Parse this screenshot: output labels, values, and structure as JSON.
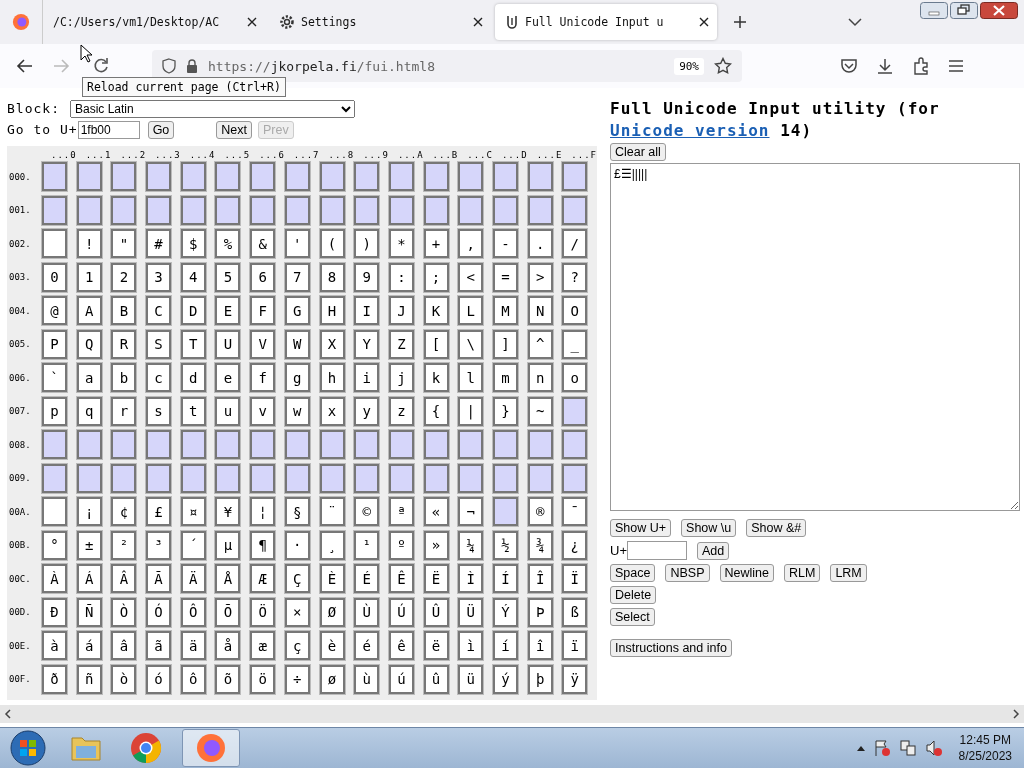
{
  "browser": {
    "tabs": [
      {
        "kind": "file",
        "title": "/C:/Users/vm1/Desktop/AC",
        "selected": false
      },
      {
        "kind": "settings",
        "title": "Settings",
        "selected": false
      },
      {
        "kind": "page",
        "title": "Full Unicode Input u",
        "selected": true
      }
    ],
    "url_scheme": "https://",
    "url_host": "jkorpela.fi",
    "url_path": "/fui.html8",
    "zoom": "90%",
    "tooltip": "Reload current page (Ctrl+R)"
  },
  "block": {
    "label": "Block:",
    "value": "Basic Latin"
  },
  "goto": {
    "label": "Go to U+",
    "value": "1fb00",
    "go": "Go",
    "next": "Next",
    "prev": "Prev",
    "prev_disabled": true
  },
  "grid": {
    "columns": [
      "...0",
      "...1",
      "...2",
      "...3",
      "...4",
      "...5",
      "...6",
      "...7",
      "...8",
      "...9",
      "...A",
      "...B",
      "...C",
      "...D",
      "...E",
      "...F"
    ],
    "rows": [
      {
        "label": "000.",
        "cells": [
          {
            "kind": "unassigned"
          },
          {
            "kind": "unassigned"
          },
          {
            "kind": "unassigned"
          },
          {
            "kind": "unassigned"
          },
          {
            "kind": "unassigned"
          },
          {
            "kind": "unassigned"
          },
          {
            "kind": "unassigned"
          },
          {
            "kind": "unassigned"
          },
          {
            "kind": "unassigned"
          },
          {
            "kind": "unassigned"
          },
          {
            "kind": "unassigned"
          },
          {
            "kind": "unassigned"
          },
          {
            "kind": "unassigned"
          },
          {
            "kind": "unassigned"
          },
          {
            "kind": "unassigned"
          },
          {
            "kind": "unassigned"
          }
        ]
      },
      {
        "label": "001.",
        "cells": [
          {
            "kind": "unassigned"
          },
          {
            "kind": "unassigned"
          },
          {
            "kind": "unassigned"
          },
          {
            "kind": "unassigned"
          },
          {
            "kind": "unassigned"
          },
          {
            "kind": "unassigned"
          },
          {
            "kind": "unassigned"
          },
          {
            "kind": "unassigned"
          },
          {
            "kind": "unassigned"
          },
          {
            "kind": "unassigned"
          },
          {
            "kind": "unassigned"
          },
          {
            "kind": "unassigned"
          },
          {
            "kind": "unassigned"
          },
          {
            "kind": "unassigned"
          },
          {
            "kind": "unassigned"
          },
          {
            "kind": "unassigned"
          }
        ]
      },
      {
        "label": "002.",
        "cells": [
          {
            "kind": "blank"
          },
          {
            "kind": "glyph",
            "char": "!"
          },
          {
            "kind": "glyph",
            "char": "\""
          },
          {
            "kind": "glyph",
            "char": "#"
          },
          {
            "kind": "glyph",
            "char": "$"
          },
          {
            "kind": "glyph",
            "char": "%"
          },
          {
            "kind": "glyph",
            "char": "&"
          },
          {
            "kind": "glyph",
            "char": "'"
          },
          {
            "kind": "glyph",
            "char": "("
          },
          {
            "kind": "glyph",
            "char": ")"
          },
          {
            "kind": "glyph",
            "char": "*"
          },
          {
            "kind": "glyph",
            "char": "+"
          },
          {
            "kind": "glyph",
            "char": ","
          },
          {
            "kind": "glyph",
            "char": "-"
          },
          {
            "kind": "glyph",
            "char": "."
          },
          {
            "kind": "glyph",
            "char": "/"
          }
        ]
      },
      {
        "label": "003.",
        "cells": [
          {
            "kind": "glyph",
            "char": "0"
          },
          {
            "kind": "glyph",
            "char": "1"
          },
          {
            "kind": "glyph",
            "char": "2"
          },
          {
            "kind": "glyph",
            "char": "3"
          },
          {
            "kind": "glyph",
            "char": "4"
          },
          {
            "kind": "glyph",
            "char": "5"
          },
          {
            "kind": "glyph",
            "char": "6"
          },
          {
            "kind": "glyph",
            "char": "7"
          },
          {
            "kind": "glyph",
            "char": "8"
          },
          {
            "kind": "glyph",
            "char": "9"
          },
          {
            "kind": "glyph",
            "char": ":"
          },
          {
            "kind": "glyph",
            "char": ";"
          },
          {
            "kind": "glyph",
            "char": "<"
          },
          {
            "kind": "glyph",
            "char": "="
          },
          {
            "kind": "glyph",
            "char": ">"
          },
          {
            "kind": "glyph",
            "char": "?"
          }
        ]
      },
      {
        "label": "004.",
        "cells": [
          {
            "kind": "glyph",
            "char": "@"
          },
          {
            "kind": "glyph",
            "char": "A"
          },
          {
            "kind": "glyph",
            "char": "B"
          },
          {
            "kind": "glyph",
            "char": "C"
          },
          {
            "kind": "glyph",
            "char": "D"
          },
          {
            "kind": "glyph",
            "char": "E"
          },
          {
            "kind": "glyph",
            "char": "F"
          },
          {
            "kind": "glyph",
            "char": "G"
          },
          {
            "kind": "glyph",
            "char": "H"
          },
          {
            "kind": "glyph",
            "char": "I"
          },
          {
            "kind": "glyph",
            "char": "J"
          },
          {
            "kind": "glyph",
            "char": "K"
          },
          {
            "kind": "glyph",
            "char": "L"
          },
          {
            "kind": "glyph",
            "char": "M"
          },
          {
            "kind": "glyph",
            "char": "N"
          },
          {
            "kind": "glyph",
            "char": "O"
          }
        ]
      },
      {
        "label": "005.",
        "cells": [
          {
            "kind": "glyph",
            "char": "P"
          },
          {
            "kind": "glyph",
            "char": "Q"
          },
          {
            "kind": "glyph",
            "char": "R"
          },
          {
            "kind": "glyph",
            "char": "S"
          },
          {
            "kind": "glyph",
            "char": "T"
          },
          {
            "kind": "glyph",
            "char": "U"
          },
          {
            "kind": "glyph",
            "char": "V"
          },
          {
            "kind": "glyph",
            "char": "W"
          },
          {
            "kind": "glyph",
            "char": "X"
          },
          {
            "kind": "glyph",
            "char": "Y"
          },
          {
            "kind": "glyph",
            "char": "Z"
          },
          {
            "kind": "glyph",
            "char": "["
          },
          {
            "kind": "glyph",
            "char": "\\"
          },
          {
            "kind": "glyph",
            "char": "]"
          },
          {
            "kind": "glyph",
            "char": "^"
          },
          {
            "kind": "glyph",
            "char": "_"
          }
        ]
      },
      {
        "label": "006.",
        "cells": [
          {
            "kind": "glyph",
            "char": "`"
          },
          {
            "kind": "glyph",
            "char": "a"
          },
          {
            "kind": "glyph",
            "char": "b"
          },
          {
            "kind": "glyph",
            "char": "c"
          },
          {
            "kind": "glyph",
            "char": "d"
          },
          {
            "kind": "glyph",
            "char": "e"
          },
          {
            "kind": "glyph",
            "char": "f"
          },
          {
            "kind": "glyph",
            "char": "g"
          },
          {
            "kind": "glyph",
            "char": "h"
          },
          {
            "kind": "glyph",
            "char": "i"
          },
          {
            "kind": "glyph",
            "char": "j"
          },
          {
            "kind": "glyph",
            "char": "k"
          },
          {
            "kind": "glyph",
            "char": "l"
          },
          {
            "kind": "glyph",
            "char": "m"
          },
          {
            "kind": "glyph",
            "char": "n"
          },
          {
            "kind": "glyph",
            "char": "o"
          }
        ]
      },
      {
        "label": "007.",
        "cells": [
          {
            "kind": "glyph",
            "char": "p"
          },
          {
            "kind": "glyph",
            "char": "q"
          },
          {
            "kind": "glyph",
            "char": "r"
          },
          {
            "kind": "glyph",
            "char": "s"
          },
          {
            "kind": "glyph",
            "char": "t"
          },
          {
            "kind": "glyph",
            "char": "u"
          },
          {
            "kind": "glyph",
            "char": "v"
          },
          {
            "kind": "glyph",
            "char": "w"
          },
          {
            "kind": "glyph",
            "char": "x"
          },
          {
            "kind": "glyph",
            "char": "y"
          },
          {
            "kind": "glyph",
            "char": "z"
          },
          {
            "kind": "glyph",
            "char": "{"
          },
          {
            "kind": "glyph",
            "char": "|"
          },
          {
            "kind": "glyph",
            "char": "}"
          },
          {
            "kind": "glyph",
            "char": "~"
          },
          {
            "kind": "unassigned"
          }
        ]
      },
      {
        "label": "008.",
        "cells": [
          {
            "kind": "unassigned"
          },
          {
            "kind": "unassigned"
          },
          {
            "kind": "unassigned"
          },
          {
            "kind": "unassigned"
          },
          {
            "kind": "unassigned"
          },
          {
            "kind": "unassigned"
          },
          {
            "kind": "unassigned"
          },
          {
            "kind": "unassigned"
          },
          {
            "kind": "unassigned"
          },
          {
            "kind": "unassigned"
          },
          {
            "kind": "unassigned"
          },
          {
            "kind": "unassigned"
          },
          {
            "kind": "unassigned"
          },
          {
            "kind": "unassigned"
          },
          {
            "kind": "unassigned"
          },
          {
            "kind": "unassigned"
          }
        ]
      },
      {
        "label": "009.",
        "cells": [
          {
            "kind": "unassigned"
          },
          {
            "kind": "unassigned"
          },
          {
            "kind": "unassigned"
          },
          {
            "kind": "unassigned"
          },
          {
            "kind": "unassigned"
          },
          {
            "kind": "unassigned"
          },
          {
            "kind": "unassigned"
          },
          {
            "kind": "unassigned"
          },
          {
            "kind": "unassigned"
          },
          {
            "kind": "unassigned"
          },
          {
            "kind": "unassigned"
          },
          {
            "kind": "unassigned"
          },
          {
            "kind": "unassigned"
          },
          {
            "kind": "unassigned"
          },
          {
            "kind": "unassigned"
          },
          {
            "kind": "unassigned"
          }
        ]
      },
      {
        "label": "00A.",
        "cells": [
          {
            "kind": "blank"
          },
          {
            "kind": "glyph",
            "char": "¡"
          },
          {
            "kind": "glyph",
            "char": "¢"
          },
          {
            "kind": "glyph",
            "char": "£"
          },
          {
            "kind": "glyph",
            "char": "¤"
          },
          {
            "kind": "glyph",
            "char": "¥"
          },
          {
            "kind": "glyph",
            "char": "¦"
          },
          {
            "kind": "glyph",
            "char": "§"
          },
          {
            "kind": "glyph",
            "char": "¨"
          },
          {
            "kind": "glyph",
            "char": "©"
          },
          {
            "kind": "glyph",
            "char": "ª"
          },
          {
            "kind": "glyph",
            "char": "«"
          },
          {
            "kind": "glyph",
            "char": "¬"
          },
          {
            "kind": "unassigned"
          },
          {
            "kind": "glyph",
            "char": "®"
          },
          {
            "kind": "glyph",
            "char": "¯"
          }
        ]
      },
      {
        "label": "00B.",
        "cells": [
          {
            "kind": "glyph",
            "char": "°"
          },
          {
            "kind": "glyph",
            "char": "±"
          },
          {
            "kind": "glyph",
            "char": "²"
          },
          {
            "kind": "glyph",
            "char": "³"
          },
          {
            "kind": "glyph",
            "char": "´"
          },
          {
            "kind": "glyph",
            "char": "µ"
          },
          {
            "kind": "glyph",
            "char": "¶"
          },
          {
            "kind": "glyph",
            "char": "·"
          },
          {
            "kind": "glyph",
            "char": "¸"
          },
          {
            "kind": "glyph",
            "char": "¹"
          },
          {
            "kind": "glyph",
            "char": "º"
          },
          {
            "kind": "glyph",
            "char": "»"
          },
          {
            "kind": "glyph",
            "char": "¼"
          },
          {
            "kind": "glyph",
            "char": "½"
          },
          {
            "kind": "glyph",
            "char": "¾"
          },
          {
            "kind": "glyph",
            "char": "¿"
          }
        ]
      },
      {
        "label": "00C.",
        "cells": [
          {
            "kind": "glyph",
            "char": "À"
          },
          {
            "kind": "glyph",
            "char": "Á"
          },
          {
            "kind": "glyph",
            "char": "Â"
          },
          {
            "kind": "glyph",
            "char": "Ã"
          },
          {
            "kind": "glyph",
            "char": "Ä"
          },
          {
            "kind": "glyph",
            "char": "Å"
          },
          {
            "kind": "glyph",
            "char": "Æ"
          },
          {
            "kind": "glyph",
            "char": "Ç"
          },
          {
            "kind": "glyph",
            "char": "È"
          },
          {
            "kind": "glyph",
            "char": "É"
          },
          {
            "kind": "glyph",
            "char": "Ê"
          },
          {
            "kind": "glyph",
            "char": "Ë"
          },
          {
            "kind": "glyph",
            "char": "Ì"
          },
          {
            "kind": "glyph",
            "char": "Í"
          },
          {
            "kind": "glyph",
            "char": "Î"
          },
          {
            "kind": "glyph",
            "char": "Ï"
          }
        ]
      },
      {
        "label": "00D.",
        "cells": [
          {
            "kind": "glyph",
            "char": "Ð"
          },
          {
            "kind": "glyph",
            "char": "Ñ"
          },
          {
            "kind": "glyph",
            "char": "Ò"
          },
          {
            "kind": "glyph",
            "char": "Ó"
          },
          {
            "kind": "glyph",
            "char": "Ô"
          },
          {
            "kind": "glyph",
            "char": "Õ"
          },
          {
            "kind": "glyph",
            "char": "Ö"
          },
          {
            "kind": "glyph",
            "char": "×"
          },
          {
            "kind": "glyph",
            "char": "Ø"
          },
          {
            "kind": "glyph",
            "char": "Ù"
          },
          {
            "kind": "glyph",
            "char": "Ú"
          },
          {
            "kind": "glyph",
            "char": "Û"
          },
          {
            "kind": "glyph",
            "char": "Ü"
          },
          {
            "kind": "glyph",
            "char": "Ý"
          },
          {
            "kind": "glyph",
            "char": "Þ"
          },
          {
            "kind": "glyph",
            "char": "ß"
          }
        ]
      },
      {
        "label": "00E.",
        "cells": [
          {
            "kind": "glyph",
            "char": "à"
          },
          {
            "kind": "glyph",
            "char": "á"
          },
          {
            "kind": "glyph",
            "char": "â"
          },
          {
            "kind": "glyph",
            "char": "ã"
          },
          {
            "kind": "glyph",
            "char": "ä"
          },
          {
            "kind": "glyph",
            "char": "å"
          },
          {
            "kind": "glyph",
            "char": "æ"
          },
          {
            "kind": "glyph",
            "char": "ç"
          },
          {
            "kind": "glyph",
            "char": "è"
          },
          {
            "kind": "glyph",
            "char": "é"
          },
          {
            "kind": "glyph",
            "char": "ê"
          },
          {
            "kind": "glyph",
            "char": "ë"
          },
          {
            "kind": "glyph",
            "char": "ì"
          },
          {
            "kind": "glyph",
            "char": "í"
          },
          {
            "kind": "glyph",
            "char": "î"
          },
          {
            "kind": "glyph",
            "char": "ï"
          }
        ]
      },
      {
        "label": "00F.",
        "cells": [
          {
            "kind": "glyph",
            "char": "ð"
          },
          {
            "kind": "glyph",
            "char": "ñ"
          },
          {
            "kind": "glyph",
            "char": "ò"
          },
          {
            "kind": "glyph",
            "char": "ó"
          },
          {
            "kind": "glyph",
            "char": "ô"
          },
          {
            "kind": "glyph",
            "char": "õ"
          },
          {
            "kind": "glyph",
            "char": "ö"
          },
          {
            "kind": "glyph",
            "char": "÷"
          },
          {
            "kind": "glyph",
            "char": "ø"
          },
          {
            "kind": "glyph",
            "char": "ù"
          },
          {
            "kind": "glyph",
            "char": "ú"
          },
          {
            "kind": "glyph",
            "char": "û"
          },
          {
            "kind": "glyph",
            "char": "ü"
          },
          {
            "kind": "glyph",
            "char": "ý"
          },
          {
            "kind": "glyph",
            "char": "þ"
          },
          {
            "kind": "glyph",
            "char": "ÿ"
          }
        ]
      }
    ]
  },
  "panel": {
    "title_start": "Full Unicode Input utility (for",
    "link": "Unicode version",
    "title_end": "14)",
    "clear": "Clear all",
    "text": "£☰|||||",
    "show_buttons": [
      "Show U+",
      "Show \\u",
      "Show &#"
    ],
    "add_label": "U+",
    "add": "Add",
    "insert_buttons": [
      "Space",
      "NBSP",
      "Newline",
      "RLM",
      "LRM"
    ],
    "delete": "Delete",
    "select": "Select",
    "info": "Instructions and info"
  },
  "taskbar": {
    "apps": [
      {
        "kind": "explorer",
        "selected": false
      },
      {
        "kind": "chrome",
        "selected": false
      },
      {
        "kind": "firefox",
        "selected": true
      }
    ],
    "time": "12:45 PM",
    "date": "8/25/2023"
  }
}
